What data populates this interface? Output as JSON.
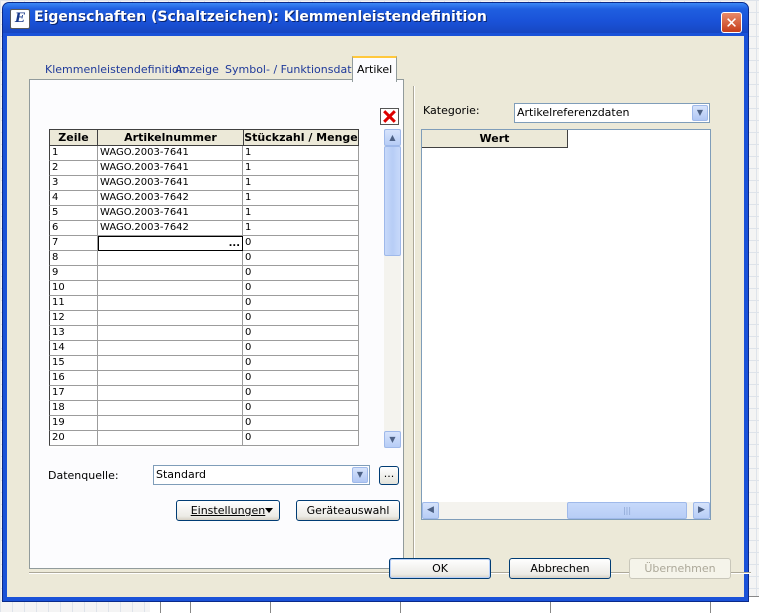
{
  "window": {
    "title": "Eigenschaften (Schaltzeichen): Klemmenleistendefinition",
    "icon": "app-icon",
    "close_label": "✕"
  },
  "tabs": [
    {
      "label": "Klemmenleistendefinition",
      "active": false
    },
    {
      "label": "Anzeige",
      "active": false
    },
    {
      "label": "Symbol- / Funktionsdaten",
      "active": false
    },
    {
      "label": "Artikel",
      "active": true
    }
  ],
  "table": {
    "columns": [
      "Zeile",
      "Artikelnummer",
      "Stückzahl / Menge"
    ],
    "rows": [
      [
        "1",
        "WAGO.2003-7641",
        "1"
      ],
      [
        "2",
        "WAGO.2003-7641",
        "1"
      ],
      [
        "3",
        "WAGO.2003-7641",
        "1"
      ],
      [
        "4",
        "WAGO.2003-7642",
        "1"
      ],
      [
        "5",
        "WAGO.2003-7641",
        "1"
      ],
      [
        "6",
        "WAGO.2003-7642",
        "1"
      ],
      [
        "7",
        "",
        "0"
      ],
      [
        "8",
        "",
        "0"
      ],
      [
        "9",
        "",
        "0"
      ],
      [
        "10",
        "",
        "0"
      ],
      [
        "11",
        "",
        "0"
      ],
      [
        "12",
        "",
        "0"
      ],
      [
        "13",
        "",
        "0"
      ],
      [
        "14",
        "",
        "0"
      ],
      [
        "15",
        "",
        "0"
      ],
      [
        "16",
        "",
        "0"
      ],
      [
        "17",
        "",
        "0"
      ],
      [
        "18",
        "",
        "0"
      ],
      [
        "19",
        "",
        "0"
      ],
      [
        "20",
        "",
        "0"
      ]
    ],
    "editing_row": 7,
    "ellipsis": "..."
  },
  "datenquelle": {
    "label": "Datenquelle:",
    "value": "Standard",
    "browse_label": "..."
  },
  "buttons": {
    "einstellungen": "Einstellungen",
    "geraeteauswahl": "Geräteauswahl",
    "ok": "OK",
    "abbrechen": "Abbrechen",
    "uebernehmen": "Übernehmen"
  },
  "kategorie": {
    "label": "Kategorie:",
    "value": "Artikelreferenzdaten",
    "column_header": "Wert"
  },
  "scroll": {
    "up": "▲",
    "down": "▼",
    "left": "◀",
    "right": "▶",
    "grip": "|||"
  }
}
